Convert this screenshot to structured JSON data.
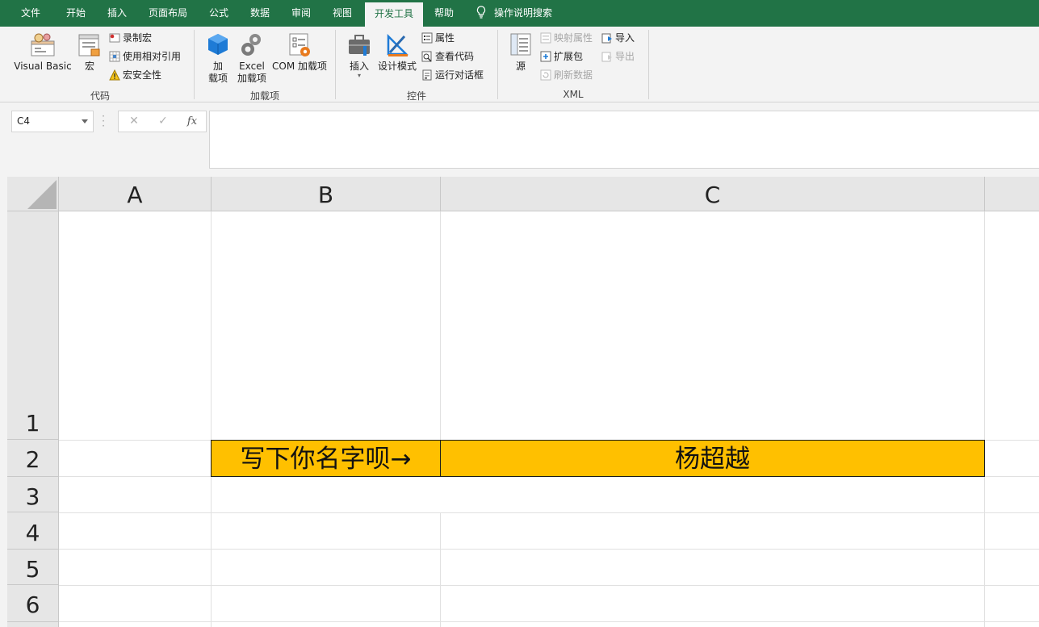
{
  "tabs": [
    "文件",
    "开始",
    "插入",
    "页面布局",
    "公式",
    "数据",
    "审阅",
    "视图",
    "开发工具",
    "帮助"
  ],
  "active_tab": "开发工具",
  "tell_me": "操作说明搜索",
  "ribbon": {
    "code": {
      "label": "代码",
      "visual_basic": "Visual Basic",
      "macros": "宏",
      "record_macro": "录制宏",
      "relative_refs": "使用相对引用",
      "macro_security": "宏安全性"
    },
    "addins": {
      "label": "加载项",
      "addins_line1": "加",
      "addins_line2": "载项",
      "excel_addins_line1": "Excel",
      "excel_addins_line2": "加载项",
      "com_addins": "COM 加载项"
    },
    "controls": {
      "label": "控件",
      "insert": "插入",
      "design_mode": "设计模式",
      "properties": "属性",
      "view_code": "查看代码",
      "run_dialog": "运行对话框"
    },
    "xml": {
      "label": "XML",
      "source": "源",
      "map_properties": "映射属性",
      "expansion_packs": "扩展包",
      "refresh_data": "刷新数据",
      "import": "导入",
      "export": "导出"
    }
  },
  "name_box": "C4",
  "formula_buttons": {
    "cancel": "✕",
    "enter": "✓",
    "fx": "fx"
  },
  "formula_value": "",
  "columns": [
    "A",
    "B",
    "C"
  ],
  "rows": [
    "1",
    "2",
    "3",
    "4",
    "5",
    "6"
  ],
  "cells": {
    "B2": "写下你名字呗→",
    "C2": "杨超越"
  },
  "colors": {
    "excel_green": "#217346",
    "cell_highlight": "#ffc000",
    "ribbon_bg": "#f3f3f3",
    "header_bg": "#e6e6e6"
  }
}
